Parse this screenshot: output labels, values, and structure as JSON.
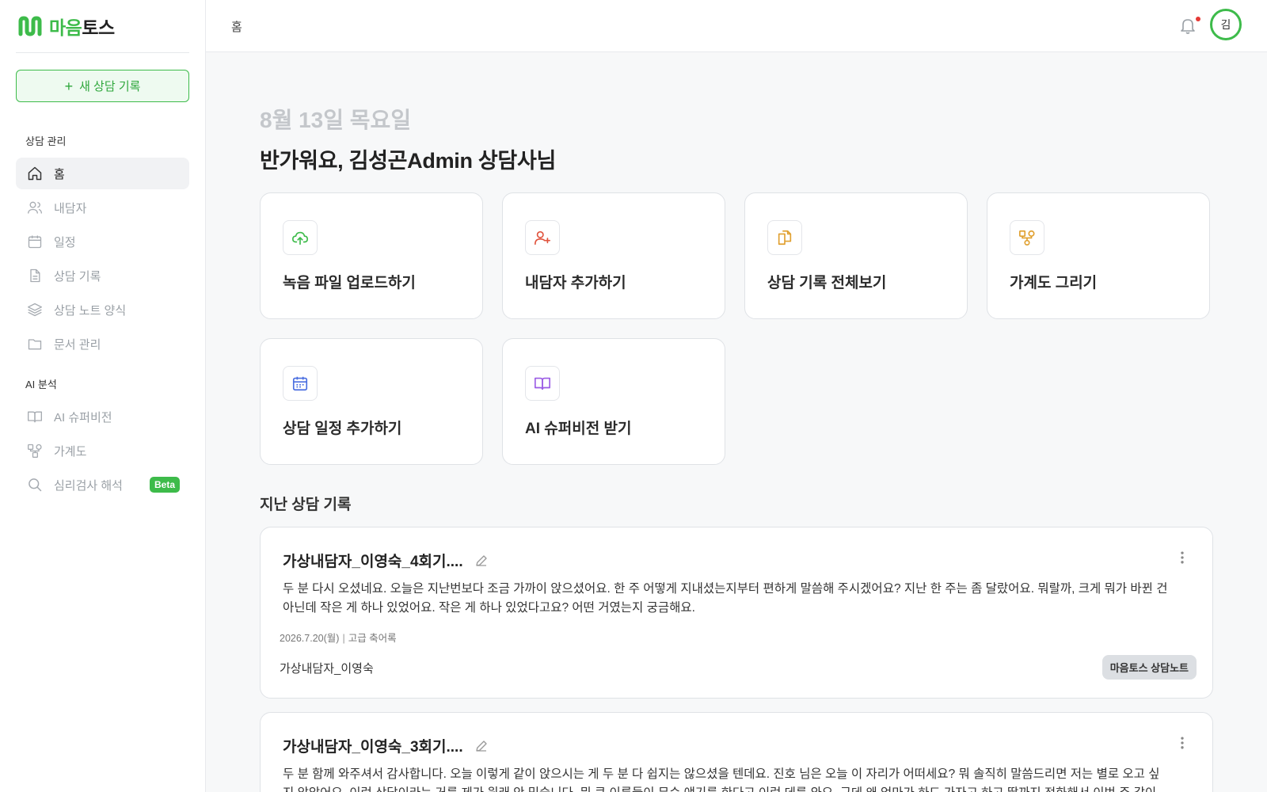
{
  "app": {
    "logo_text_green": "마음",
    "logo_text_dark": "토스"
  },
  "sidebar": {
    "new_button": "새 상담 기록",
    "section_counsel": "상담 관리",
    "section_ai": "AI 분석",
    "items": [
      {
        "label": "홈",
        "icon": "home-icon",
        "active": true
      },
      {
        "label": "내담자",
        "icon": "users-icon"
      },
      {
        "label": "일정",
        "icon": "calendar-icon"
      },
      {
        "label": "상담 기록",
        "icon": "document-icon"
      },
      {
        "label": "상담 노트 양식",
        "icon": "layers-icon"
      },
      {
        "label": "문서 관리",
        "icon": "folder-icon"
      },
      {
        "label": "AI 슈퍼비전",
        "icon": "book-open-icon"
      },
      {
        "label": "가계도",
        "icon": "genogram-icon"
      },
      {
        "label": "심리검사 해석",
        "icon": "search-icon",
        "badge": "Beta"
      }
    ]
  },
  "header": {
    "breadcrumb": "홈",
    "avatar_initial": "김"
  },
  "main": {
    "date": "8월 13일 목요일",
    "greeting": "반가워요, 김성곤Admin 상담사님",
    "quick_actions": [
      {
        "label": "녹음 파일 업로드하기",
        "icon": "upload-cloud-icon",
        "color": "#3dbb4a"
      },
      {
        "label": "내담자 추가하기",
        "icon": "user-plus-icon",
        "color": "#e0533d"
      },
      {
        "label": "상담 기록 전체보기",
        "icon": "copy-document-icon",
        "color": "#e0a030"
      },
      {
        "label": "가계도 그리기",
        "icon": "genogram-icon",
        "color": "#e0a030"
      },
      {
        "label": "상담 일정 추가하기",
        "icon": "calendar-icon",
        "color": "#4a6ee0"
      },
      {
        "label": "AI 슈퍼비전 받기",
        "icon": "book-open-icon",
        "color": "#9b5de5"
      }
    ],
    "recent_title": "지난 상담 기록",
    "records": [
      {
        "title": "가상내담자_이영숙_4회기....",
        "body": "두 분 다시 오셨네요. 오늘은 지난번보다 조금 가까이 앉으셨어요. 한 주 어떻게 지내셨는지부터 편하게 말씀해 주시겠어요? 지난 한 주는 좀 달랐어요. 뭐랄까, 크게 뭐가 바뀐 건 아닌데 작은 게 하나 있었어요. 작은 게 하나 있었다고요? 어떤 거였는지 궁금해요.",
        "date": "2026.7.20(월)",
        "type": "고급 축어록",
        "client": "가상내담자_이영숙",
        "tag": "마음토스 상담노트"
      },
      {
        "title": "가상내담자_이영숙_3회기....",
        "body": "두 분 함께 와주셔서 감사합니다. 오늘 이렇게 같이 앉으시는 게 두 분 다 쉽지는 않으셨을 텐데요. 진호 님은 오늘 이 자리가 어떠세요? 뭐 솔직히 말씀드리면 저는 별로 오고 싶지 않았어요. 이런 상담이라는 거를 제가 원래 안 믿습니다. 뭐 큰 이름들이 무슨 얘기를 한다고 이런 데를 와요. 근데 왜 엄마가 하도 가자고 하고 딸까지 전화해서 이번 주 같이 가달라고 하니까 뭐 어쩌",
        "date": "",
        "type": "",
        "client": "",
        "tag": ""
      }
    ]
  }
}
